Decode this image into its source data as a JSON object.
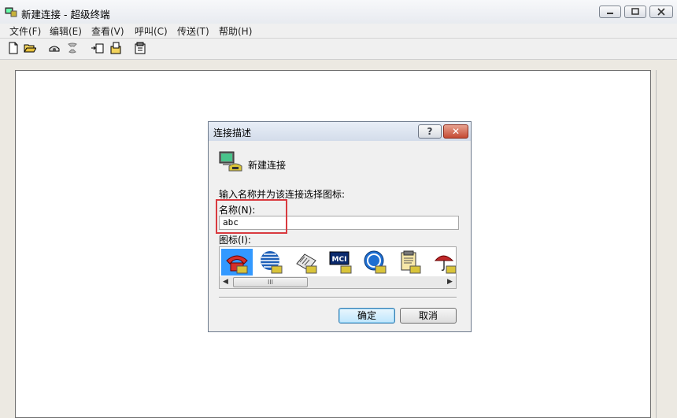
{
  "window": {
    "title": "新建连接 - 超级终端",
    "icon": "hyperterminal-icon"
  },
  "menu": [
    {
      "label": "文件(F)"
    },
    {
      "label": "编辑(E)"
    },
    {
      "label": "查看(V)"
    },
    {
      "label": "呼叫(C)"
    },
    {
      "label": "传送(T)"
    },
    {
      "label": "帮助(H)"
    }
  ],
  "toolbar": {
    "icons": [
      "new-icon",
      "open-icon",
      "call-icon",
      "disconnect-icon",
      "send-icon",
      "receive-icon",
      "properties-icon"
    ]
  },
  "dialog": {
    "title": "连接描述",
    "help_label": "?",
    "close_label": "✕",
    "connection_name": "新建连接",
    "prompt": "输入名称并为该连接选择图标:",
    "name_label": "名称(N):",
    "name_value": "abc",
    "icon_label": "图标(I):",
    "icons": [
      "phone-icon",
      "globe-icon",
      "fax-icon",
      "mci-icon",
      "ge-icon",
      "file-icon",
      "umbrella-icon"
    ],
    "icon_text_mci": "MCI",
    "scroll_thumb": "III",
    "ok_label": "确定",
    "cancel_label": "取消"
  },
  "colors": {
    "highlight": "#d93a3f",
    "selection": "#3399ff"
  }
}
